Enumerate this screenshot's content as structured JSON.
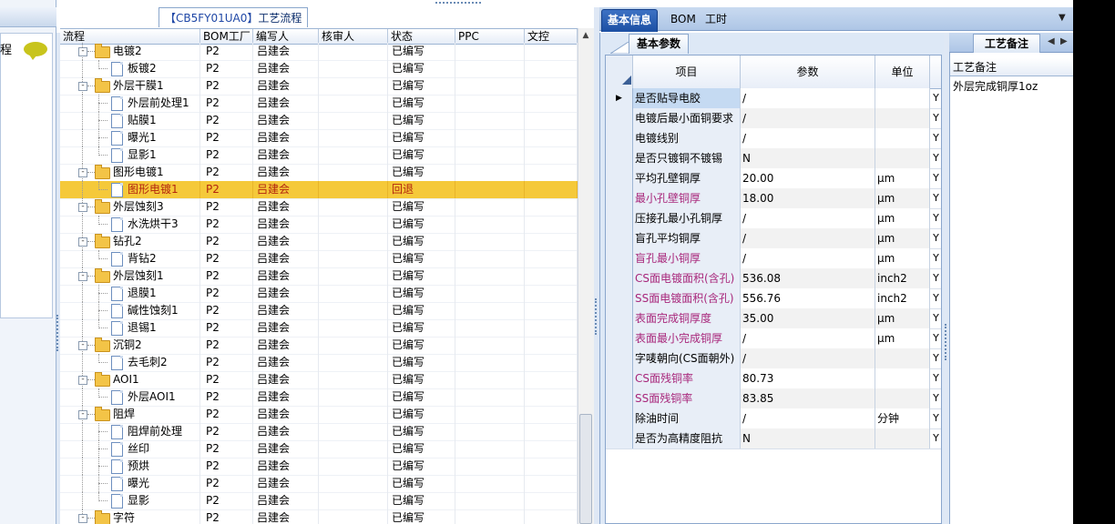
{
  "left_panel": {
    "text": "程"
  },
  "process": {
    "title_code": "【CB5FY01UA0】",
    "title_label": "工艺流程"
  },
  "grid": {
    "columns": [
      "流程",
      "BOM工厂",
      "编写人",
      "核审人",
      "状态",
      "PPC",
      "文控"
    ],
    "rows": [
      {
        "level": 1,
        "type": "folder",
        "name": "电镀2",
        "bom": "P2",
        "writer": "吕建会",
        "reviewer": "",
        "status": "已编写",
        "ppc": "",
        "ctl": ""
      },
      {
        "level": 2,
        "type": "file",
        "name": "板镀2",
        "bom": "P2",
        "writer": "吕建会",
        "reviewer": "",
        "status": "已编写",
        "ppc": "",
        "ctl": ""
      },
      {
        "level": 1,
        "type": "folder",
        "name": "外层干膜1",
        "bom": "P2",
        "writer": "吕建会",
        "reviewer": "",
        "status": "已编写",
        "ppc": "",
        "ctl": ""
      },
      {
        "level": 2,
        "type": "file",
        "name": "外层前处理1",
        "bom": "P2",
        "writer": "吕建会",
        "reviewer": "",
        "status": "已编写",
        "ppc": "",
        "ctl": ""
      },
      {
        "level": 2,
        "type": "file",
        "name": "贴膜1",
        "bom": "P2",
        "writer": "吕建会",
        "reviewer": "",
        "status": "已编写",
        "ppc": "",
        "ctl": ""
      },
      {
        "level": 2,
        "type": "file",
        "name": "曝光1",
        "bom": "P2",
        "writer": "吕建会",
        "reviewer": "",
        "status": "已编写",
        "ppc": "",
        "ctl": ""
      },
      {
        "level": 2,
        "type": "file",
        "name": "显影1",
        "bom": "P2",
        "writer": "吕建会",
        "reviewer": "",
        "status": "已编写",
        "ppc": "",
        "ctl": ""
      },
      {
        "level": 1,
        "type": "folder",
        "name": "图形电镀1",
        "bom": "P2",
        "writer": "吕建会",
        "reviewer": "",
        "status": "已编写",
        "ppc": "",
        "ctl": ""
      },
      {
        "level": 2,
        "type": "file",
        "name": "图形电镀1",
        "bom": "P2",
        "writer": "吕建会",
        "reviewer": "",
        "status": "回退",
        "ppc": "",
        "ctl": "",
        "selected": true
      },
      {
        "level": 1,
        "type": "folder",
        "name": "外层蚀刻3",
        "bom": "P2",
        "writer": "吕建会",
        "reviewer": "",
        "status": "已编写",
        "ppc": "",
        "ctl": ""
      },
      {
        "level": 2,
        "type": "file",
        "name": "水洗烘干3",
        "bom": "P2",
        "writer": "吕建会",
        "reviewer": "",
        "status": "已编写",
        "ppc": "",
        "ctl": ""
      },
      {
        "level": 1,
        "type": "folder",
        "name": "钻孔2",
        "bom": "P2",
        "writer": "吕建会",
        "reviewer": "",
        "status": "已编写",
        "ppc": "",
        "ctl": ""
      },
      {
        "level": 2,
        "type": "file",
        "name": "背钻2",
        "bom": "P2",
        "writer": "吕建会",
        "reviewer": "",
        "status": "已编写",
        "ppc": "",
        "ctl": ""
      },
      {
        "level": 1,
        "type": "folder",
        "name": "外层蚀刻1",
        "bom": "P2",
        "writer": "吕建会",
        "reviewer": "",
        "status": "已编写",
        "ppc": "",
        "ctl": ""
      },
      {
        "level": 2,
        "type": "file",
        "name": "退膜1",
        "bom": "P2",
        "writer": "吕建会",
        "reviewer": "",
        "status": "已编写",
        "ppc": "",
        "ctl": ""
      },
      {
        "level": 2,
        "type": "file",
        "name": "碱性蚀刻1",
        "bom": "P2",
        "writer": "吕建会",
        "reviewer": "",
        "status": "已编写",
        "ppc": "",
        "ctl": ""
      },
      {
        "level": 2,
        "type": "file",
        "name": "退锡1",
        "bom": "P2",
        "writer": "吕建会",
        "reviewer": "",
        "status": "已编写",
        "ppc": "",
        "ctl": ""
      },
      {
        "level": 1,
        "type": "folder",
        "name": "沉铜2",
        "bom": "P2",
        "writer": "吕建会",
        "reviewer": "",
        "status": "已编写",
        "ppc": "",
        "ctl": ""
      },
      {
        "level": 2,
        "type": "file",
        "name": "去毛刺2",
        "bom": "P2",
        "writer": "吕建会",
        "reviewer": "",
        "status": "已编写",
        "ppc": "",
        "ctl": ""
      },
      {
        "level": 1,
        "type": "folder",
        "name": "AOI1",
        "bom": "P2",
        "writer": "吕建会",
        "reviewer": "",
        "status": "已编写",
        "ppc": "",
        "ctl": ""
      },
      {
        "level": 2,
        "type": "file",
        "name": "外层AOI1",
        "bom": "P2",
        "writer": "吕建会",
        "reviewer": "",
        "status": "已编写",
        "ppc": "",
        "ctl": ""
      },
      {
        "level": 1,
        "type": "folder",
        "name": "阻焊",
        "bom": "P2",
        "writer": "吕建会",
        "reviewer": "",
        "status": "已编写",
        "ppc": "",
        "ctl": ""
      },
      {
        "level": 2,
        "type": "file",
        "name": "阻焊前处理",
        "bom": "P2",
        "writer": "吕建会",
        "reviewer": "",
        "status": "已编写",
        "ppc": "",
        "ctl": ""
      },
      {
        "level": 2,
        "type": "file",
        "name": "丝印",
        "bom": "P2",
        "writer": "吕建会",
        "reviewer": "",
        "status": "已编写",
        "ppc": "",
        "ctl": ""
      },
      {
        "level": 2,
        "type": "file",
        "name": "预烘",
        "bom": "P2",
        "writer": "吕建会",
        "reviewer": "",
        "status": "已编写",
        "ppc": "",
        "ctl": ""
      },
      {
        "level": 2,
        "type": "file",
        "name": "曝光",
        "bom": "P2",
        "writer": "吕建会",
        "reviewer": "",
        "status": "已编写",
        "ppc": "",
        "ctl": ""
      },
      {
        "level": 2,
        "type": "file",
        "name": "显影",
        "bom": "P2",
        "writer": "吕建会",
        "reviewer": "",
        "status": "已编写",
        "ppc": "",
        "ctl": ""
      },
      {
        "level": 1,
        "type": "folder",
        "name": "字符",
        "bom": "P2",
        "writer": "吕建会",
        "reviewer": "",
        "status": "已编写",
        "ppc": "",
        "ctl": ""
      }
    ]
  },
  "right_tabs": {
    "basic_info": "基本信息",
    "bom": "BOM",
    "hours": "工时",
    "dropdown_icon": "chevron-down-icon"
  },
  "params": {
    "tab_label": "基本参数",
    "columns": {
      "item": "项目",
      "value": "参数",
      "unit": "单位"
    },
    "rows": [
      {
        "item": "是否贴导电胶",
        "value": "/",
        "unit": "",
        "flag": "Y",
        "selected": true
      },
      {
        "item": "电镀后最小面铜要求",
        "value": "/",
        "unit": "",
        "flag": "Y"
      },
      {
        "item": "电镀线别",
        "value": "/",
        "unit": "",
        "flag": "Y"
      },
      {
        "item": "是否只镀铜不镀锡",
        "value": "N",
        "unit": "",
        "flag": "Y"
      },
      {
        "item": "平均孔壁铜厚",
        "value": "20.00",
        "unit": "μm",
        "flag": "Y"
      },
      {
        "item": "最小孔壁铜厚",
        "value": "18.00",
        "unit": "μm",
        "flag": "Y",
        "highlight": true
      },
      {
        "item": "压接孔最小孔铜厚",
        "value": "/",
        "unit": "μm",
        "flag": "Y"
      },
      {
        "item": "盲孔平均铜厚",
        "value": "/",
        "unit": "μm",
        "flag": "Y"
      },
      {
        "item": "盲孔最小铜厚",
        "value": "/",
        "unit": "μm",
        "flag": "Y",
        "highlight": true
      },
      {
        "item": "CS面电镀面积(含孔)",
        "value": "536.08",
        "unit": "inch2",
        "flag": "Y",
        "highlight": true
      },
      {
        "item": "SS面电镀面积(含孔)",
        "value": "556.76",
        "unit": "inch2",
        "flag": "Y",
        "highlight": true
      },
      {
        "item": "表面完成铜厚度",
        "value": "35.00",
        "unit": "μm",
        "flag": "Y",
        "highlight": true
      },
      {
        "item": "表面最小完成铜厚",
        "value": "/",
        "unit": "μm",
        "flag": "Y",
        "highlight": true
      },
      {
        "item": "字唛朝向(CS面朝外)",
        "value": "/",
        "unit": "",
        "flag": "Y"
      },
      {
        "item": "CS面残铜率",
        "value": "80.73",
        "unit": "",
        "flag": "Y",
        "highlight": true
      },
      {
        "item": "SS面残铜率",
        "value": "83.85",
        "unit": "",
        "flag": "Y",
        "highlight": true
      },
      {
        "item": "除油时间",
        "value": "/",
        "unit": "分钟",
        "flag": "Y"
      },
      {
        "item": "是否为高精度阻抗",
        "value": "N",
        "unit": "",
        "flag": "Y"
      }
    ]
  },
  "notes": {
    "tab_label": "工艺备注",
    "header": "工艺备注",
    "value": "外层完成铜厚1oz",
    "prev_icon": "◀",
    "next_icon": "▶"
  }
}
